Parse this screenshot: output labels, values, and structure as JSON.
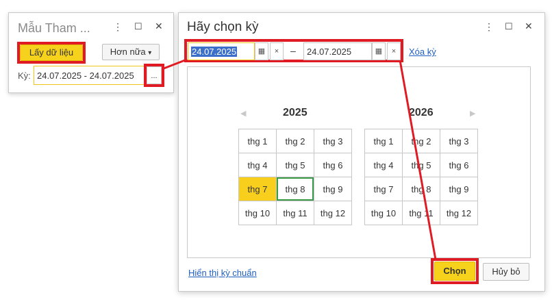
{
  "window_small": {
    "title": "Mẫu Tham ...",
    "menu_icon": "⋮",
    "maximize_icon": "☐",
    "close_icon": "✕",
    "get_data_label": "Lấy dữ liệu",
    "more_label": "Hơn nữa",
    "more_arrow": "▾",
    "period_label": "Kỳ:",
    "period_value": "24.07.2025 - 24.07.2025",
    "ellipsis_label": "..."
  },
  "window_dialog": {
    "title": "Hãy chọn kỳ",
    "menu_icon": "⋮",
    "maximize_icon": "☐",
    "close_icon": "✕",
    "start_date": "24.07.2025",
    "end_date": "24.07.2025",
    "calendar_icon": "▦",
    "clear_icon": "×",
    "dash": "–",
    "clear_period_link": "Xóa kỳ",
    "prev_arrow": "◀",
    "next_arrow": "▶",
    "years": [
      {
        "year": "2025",
        "months": [
          "thg 1",
          "thg 2",
          "thg 3",
          "thg 4",
          "thg 5",
          "thg 6",
          "thg 7",
          "thg 8",
          "thg 9",
          "thg 10",
          "thg 11",
          "thg 12"
        ]
      },
      {
        "year": "2026",
        "months": [
          "thg 1",
          "thg 2",
          "thg 3",
          "thg 4",
          "thg 5",
          "thg 6",
          "thg 7",
          "thg 8",
          "thg 9",
          "thg 10",
          "thg 11",
          "thg 12"
        ]
      }
    ],
    "show_standard_link": "Hiển thị kỳ chuẩn",
    "choose_label": "Chọn",
    "cancel_label": "Hủy bỏ"
  },
  "colors": {
    "accent_yellow": "#f7d21c",
    "highlight_red": "#e01b24",
    "link_blue": "#1f5fbf",
    "current_month_green": "#3a9a4a"
  }
}
